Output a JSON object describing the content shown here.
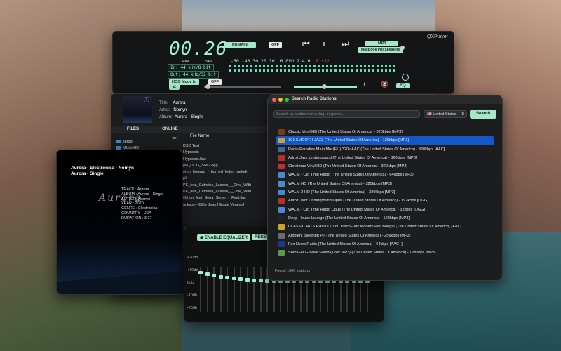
{
  "player": {
    "window_title": "QXPlayer",
    "time": "00.26",
    "time_min": "MIN",
    "time_sec": "SEC",
    "remain": "REMAIN",
    "remain_state": "OFF",
    "format_in": "In: 44 kHz/8 bit",
    "format_out": "Out: 44 kHz/32 bit",
    "hog_mode": "HOG Mode In",
    "hog_state": "OFF",
    "vu_scale_1": "-50 -40 30 20 10",
    "vu_scale_2": "6 0VU 2 4 6",
    "vu_red": "8 +12",
    "codec": "MP3",
    "output_device": "MacBook Pro Speakers",
    "eq_button": "EQ"
  },
  "track_info": {
    "title_label": "Title:",
    "title": "Aurora",
    "artist_label": "Artist:",
    "artist": "Nomyn",
    "album_label": "Album:",
    "album": "Aurora - Single"
  },
  "files": {
    "tab_files": "FILES",
    "tab_online": "ONLINE",
    "column_header": "File Name",
    "folders": [
      "serge",
      "MUsicHD"
    ],
    "items": [
      "DSD Test",
      "Hypnosis",
      "Hypnosis.flac",
      "ple_OOG_SMG.ogg",
      "eton_howard_-_burned_letter_melodi",
      "p3",
      "PE_feat_Cathrine_Lassen_-_Dive_With",
      "PE_feat_Cathrine_Lassen_-_Dive_With",
      "Orhan_feat_Sena_Sener_-_Feel.flac",
      "ackson - Billie Jean [Single Version]"
    ]
  },
  "nowplaying": {
    "heading": "Aurora - Electronica - Nomyn\nAurora - Single",
    "logo": "Aurora",
    "details": "TRACK : Aurora\nALBUM : Aurora - Single\nARTIST : Nomyn\nYEAR : 2020\nGENRE : Electronica\nCOUNTRY : USA\nDURATION : 3:37"
  },
  "equalizer": {
    "enable_label": "ENABLE EQUALIZER",
    "reset_label": "RESET",
    "db_labels": [
      "+20db",
      "+10db",
      "0db",
      "-10db",
      "-20db"
    ]
  },
  "radio": {
    "window_title": "Search Radio Stations",
    "search_placeholder": "Search by station name, tag, or genre...",
    "country": "United States",
    "search_button": "Search",
    "stations": [
      {
        "name": "Classic Vinyl HD (The United States Of America) - 320kbps [MP3]",
        "color": "#7a3a20"
      },
      {
        "name": "101 SMOOTH JAZZ (The United States Of America) - 128kbps [MP3]",
        "color": "#c8a040"
      },
      {
        "name": "Radio Paradise Main Mix (EU) 320k AAC (The United States Of America) - 320kbps [AAC]",
        "color": "#3a6a9a"
      },
      {
        "name": "Adroit Jazz Underground (The United States Of America) - 320kbps [MP3]",
        "color": "#b83020"
      },
      {
        "name": "Christmas Vinyl HD (The United States Of America) - 320kbps [MP3]",
        "color": "#c03030"
      },
      {
        "name": "WALM - Old Time Radio (The United States Of America) - 64kbps [MP3]",
        "color": "#4a8ad0"
      },
      {
        "name": "WALM HD (The United States Of America) - 320kbps [MP3]",
        "color": "#4a8ad0"
      },
      {
        "name": "WALM 2 HD (The United States Of America) - 320kbps [MP3]",
        "color": "#4a8ad0"
      },
      {
        "name": "Adroit Jazz Underground Opus (The United States Of America) - 192kbps [OGG]",
        "color": "#b83020"
      },
      {
        "name": "WALM - Old Time Radio Opus (The United States Of America) - 32kbps [OGG]",
        "color": "#4a8ad0"
      },
      {
        "name": "Deep House Lounge (The United States Of America) - 128kbps [MP3]",
        "color": "#222222"
      },
      {
        "name": "CLASSIC HITS RADIO 70 80 DiscoFunk ModernSoul Boogie (The United States Of America) [AAC]",
        "color": "#d0a030"
      },
      {
        "name": "Ambient Sleeping Pill (The United States Of America) - 256kbps [MP3]",
        "color": "#6a6a6a"
      },
      {
        "name": "Fox News Radio (The United States Of America) - 64kbps [AAC+]",
        "color": "#1a3a8a"
      },
      {
        "name": "SomaFM Groove Salad (128k MP3) (The United States Of America) - 128kbps [MP3]",
        "color": "#5a9a4a"
      }
    ],
    "selected_index": 1,
    "found_text": "Found 1000 stations"
  }
}
